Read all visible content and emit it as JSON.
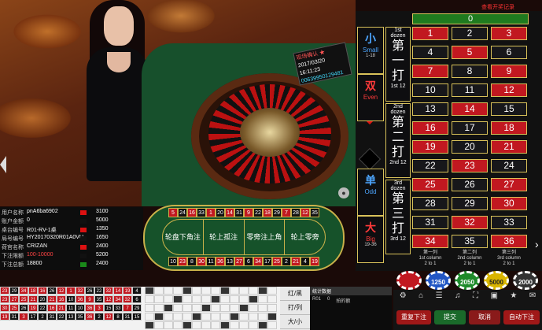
{
  "top_link": "查看开奖记录",
  "result_sign": {
    "line1": "现场确认 ★",
    "line2": "2017/03/20 16:11:23",
    "line3": "00639950129481"
  },
  "zero": "0",
  "sides": [
    {
      "zh": "小",
      "en": "Small",
      "range": "1-18",
      "color": "#4da6ff"
    },
    {
      "zh": "双",
      "en": "Even",
      "range": "",
      "color": "#ff3a3a"
    },
    {
      "zh": "单",
      "en": "Odd",
      "range": "",
      "color": "#4da6ff"
    },
    {
      "zh": "大",
      "en": "Big",
      "range": "19-36",
      "color": "#ff3a3a"
    }
  ],
  "dozens": [
    {
      "top": "1st dozen",
      "zh": "第一打",
      "bottom": "1st 12"
    },
    {
      "top": "2nd dozen",
      "zh": "第二打",
      "bottom": "2nd 12"
    },
    {
      "top": "3rd dozen",
      "zh": "第三打",
      "bottom": "3rd 12"
    }
  ],
  "numbers": [
    [
      "1",
      "red"
    ],
    [
      "2",
      "black"
    ],
    [
      "3",
      "red"
    ],
    [
      "4",
      "black"
    ],
    [
      "5",
      "red"
    ],
    [
      "6",
      "black"
    ],
    [
      "7",
      "red"
    ],
    [
      "8",
      "black"
    ],
    [
      "9",
      "red"
    ],
    [
      "10",
      "black"
    ],
    [
      "11",
      "black"
    ],
    [
      "12",
      "red"
    ],
    [
      "13",
      "black"
    ],
    [
      "14",
      "red"
    ],
    [
      "15",
      "black"
    ],
    [
      "16",
      "red"
    ],
    [
      "17",
      "black"
    ],
    [
      "18",
      "red"
    ],
    [
      "19",
      "red"
    ],
    [
      "20",
      "black"
    ],
    [
      "21",
      "red"
    ],
    [
      "22",
      "black"
    ],
    [
      "23",
      "red"
    ],
    [
      "24",
      "black"
    ],
    [
      "25",
      "red"
    ],
    [
      "26",
      "black"
    ],
    [
      "27",
      "red"
    ],
    [
      "28",
      "black"
    ],
    [
      "29",
      "black"
    ],
    [
      "30",
      "red"
    ],
    [
      "31",
      "black"
    ],
    [
      "32",
      "red"
    ],
    [
      "33",
      "black"
    ],
    [
      "34",
      "red"
    ],
    [
      "35",
      "black"
    ],
    [
      "36",
      "red"
    ]
  ],
  "columns": [
    {
      "zh": "第一列",
      "en": "1st column",
      "pay": "2 to 1"
    },
    {
      "zh": "第二列",
      "en": "2nd column",
      "pay": "2 to 1"
    },
    {
      "zh": "第三列",
      "en": "3rd column",
      "pay": "2 to 1"
    }
  ],
  "track": {
    "top": [
      [
        "5",
        "red"
      ],
      [
        "24",
        "black"
      ],
      [
        "16",
        "red"
      ],
      [
        "33",
        "black"
      ],
      [
        "1",
        "red"
      ],
      [
        "20",
        "black"
      ],
      [
        "14",
        "red"
      ],
      [
        "31",
        "black"
      ],
      [
        "9",
        "red"
      ],
      [
        "22",
        "black"
      ],
      [
        "18",
        "red"
      ],
      [
        "29",
        "black"
      ],
      [
        "7",
        "red"
      ],
      [
        "28",
        "black"
      ],
      [
        "12",
        "red"
      ],
      [
        "35",
        "black"
      ]
    ],
    "bottom": [
      [
        "10",
        "black"
      ],
      [
        "23",
        "red"
      ],
      [
        "8",
        "black"
      ],
      [
        "30",
        "red"
      ],
      [
        "11",
        "black"
      ],
      [
        "36",
        "red"
      ],
      [
        "13",
        "black"
      ],
      [
        "27",
        "red"
      ],
      [
        "6",
        "black"
      ],
      [
        "34",
        "red"
      ],
      [
        "17",
        "black"
      ],
      [
        "25",
        "red"
      ],
      [
        "2",
        "black"
      ],
      [
        "21",
        "red"
      ],
      [
        "4",
        "black"
      ],
      [
        "19",
        "red"
      ]
    ],
    "sections": [
      "轮盘下角注",
      "轮上孤注",
      "零旁注上角",
      "轮上零旁"
    ]
  },
  "info": [
    {
      "label": "用户名称",
      "value": "pnA6ba6902",
      "limit": "3100",
      "swatch": "#d11"
    },
    {
      "label": "账户金额",
      "value": "0",
      "limit": "5000",
      "swatch": "#111"
    },
    {
      "label": "桌台编号",
      "value": "R01-RV-1桌",
      "limit": "1350",
      "swatch": "#d11"
    },
    {
      "label": "局号编号",
      "value": "HY20170320R01A0VU",
      "limit": "1650",
      "swatch": "#111"
    },
    {
      "label": "荷官名称",
      "value": "CRIZAN",
      "limit": "2400",
      "swatch": "#d11"
    },
    {
      "label": "下注限额",
      "value": "100-10000",
      "limit": "5200",
      "swatch": "#111"
    },
    {
      "label": "下注总额",
      "value": "18800",
      "limit": "2400",
      "swatch": "#1a8a1a"
    }
  ],
  "chips": [
    {
      "label": "",
      "color": "#c11820"
    },
    {
      "label": "1250",
      "color": "#2256c4"
    },
    {
      "label": "2050",
      "color": "#1f8a2a"
    },
    {
      "label": "5000",
      "color": "#d9b400"
    },
    {
      "label": "2000",
      "color": "#333"
    }
  ],
  "tools": [
    "⚙",
    "⌂",
    "☰",
    "♫",
    "⛶",
    "▣",
    "★",
    "✉"
  ],
  "buttons": {
    "repeat": "重复下注",
    "confirm": "提交",
    "cancel": "取消",
    "auto": "自动下注"
  },
  "road_tabs": [
    "红/黑",
    "打/列",
    "大/小"
  ],
  "stats": {
    "title": "统计数据",
    "table": "R01",
    "count": "0",
    "text": "拍的额"
  },
  "roadmap": [
    [
      "23",
      "red"
    ],
    [
      "29",
      "black"
    ],
    [
      "34",
      "red"
    ],
    [
      "18",
      "red"
    ],
    [
      "16",
      "red"
    ],
    [
      "26",
      "black"
    ],
    [
      "12",
      "red"
    ],
    [
      "1",
      "red"
    ],
    [
      "32",
      "red"
    ],
    [
      "26",
      "black"
    ],
    [
      "22",
      "black"
    ],
    [
      "32",
      "red"
    ],
    [
      "14",
      "red"
    ],
    [
      "19",
      "red"
    ],
    [
      "4",
      "black"
    ],
    [
      "23",
      "red"
    ],
    [
      "27",
      "red"
    ],
    [
      "25",
      "red"
    ],
    [
      "21",
      "red"
    ],
    [
      "20",
      "black"
    ],
    [
      "21",
      "red"
    ],
    [
      "16",
      "red"
    ],
    [
      "10",
      "black"
    ],
    [
      "36",
      "red"
    ],
    [
      "9",
      "red"
    ],
    [
      "35",
      "black"
    ],
    [
      "12",
      "red"
    ],
    [
      "34",
      "red"
    ],
    [
      "32",
      "red"
    ],
    [
      "6",
      "black"
    ],
    [
      "30",
      "red"
    ],
    [
      "25",
      "red"
    ],
    [
      "26",
      "black"
    ],
    [
      "19",
      "red"
    ],
    [
      "22",
      "black"
    ],
    [
      "16",
      "red"
    ],
    [
      "21",
      "red"
    ],
    [
      "11",
      "black"
    ],
    [
      "10",
      "black"
    ],
    [
      "36",
      "red"
    ],
    [
      "3",
      "red"
    ],
    [
      "15",
      "black"
    ],
    [
      "33",
      "black"
    ],
    [
      "7",
      "red"
    ],
    [
      "29",
      "black"
    ],
    [
      "19",
      "red"
    ],
    [
      "31",
      "black"
    ],
    [
      "3",
      "red"
    ],
    [
      "17",
      "black"
    ],
    [
      "2",
      "black"
    ],
    [
      "31",
      "black"
    ],
    [
      "22",
      "black"
    ],
    [
      "13",
      "black"
    ],
    [
      "35",
      "black"
    ],
    [
      "36",
      "red"
    ],
    [
      "2",
      "black"
    ],
    [
      "12",
      "red"
    ],
    [
      "8",
      "black"
    ],
    [
      "31",
      "black"
    ],
    [
      "15",
      "black"
    ]
  ]
}
